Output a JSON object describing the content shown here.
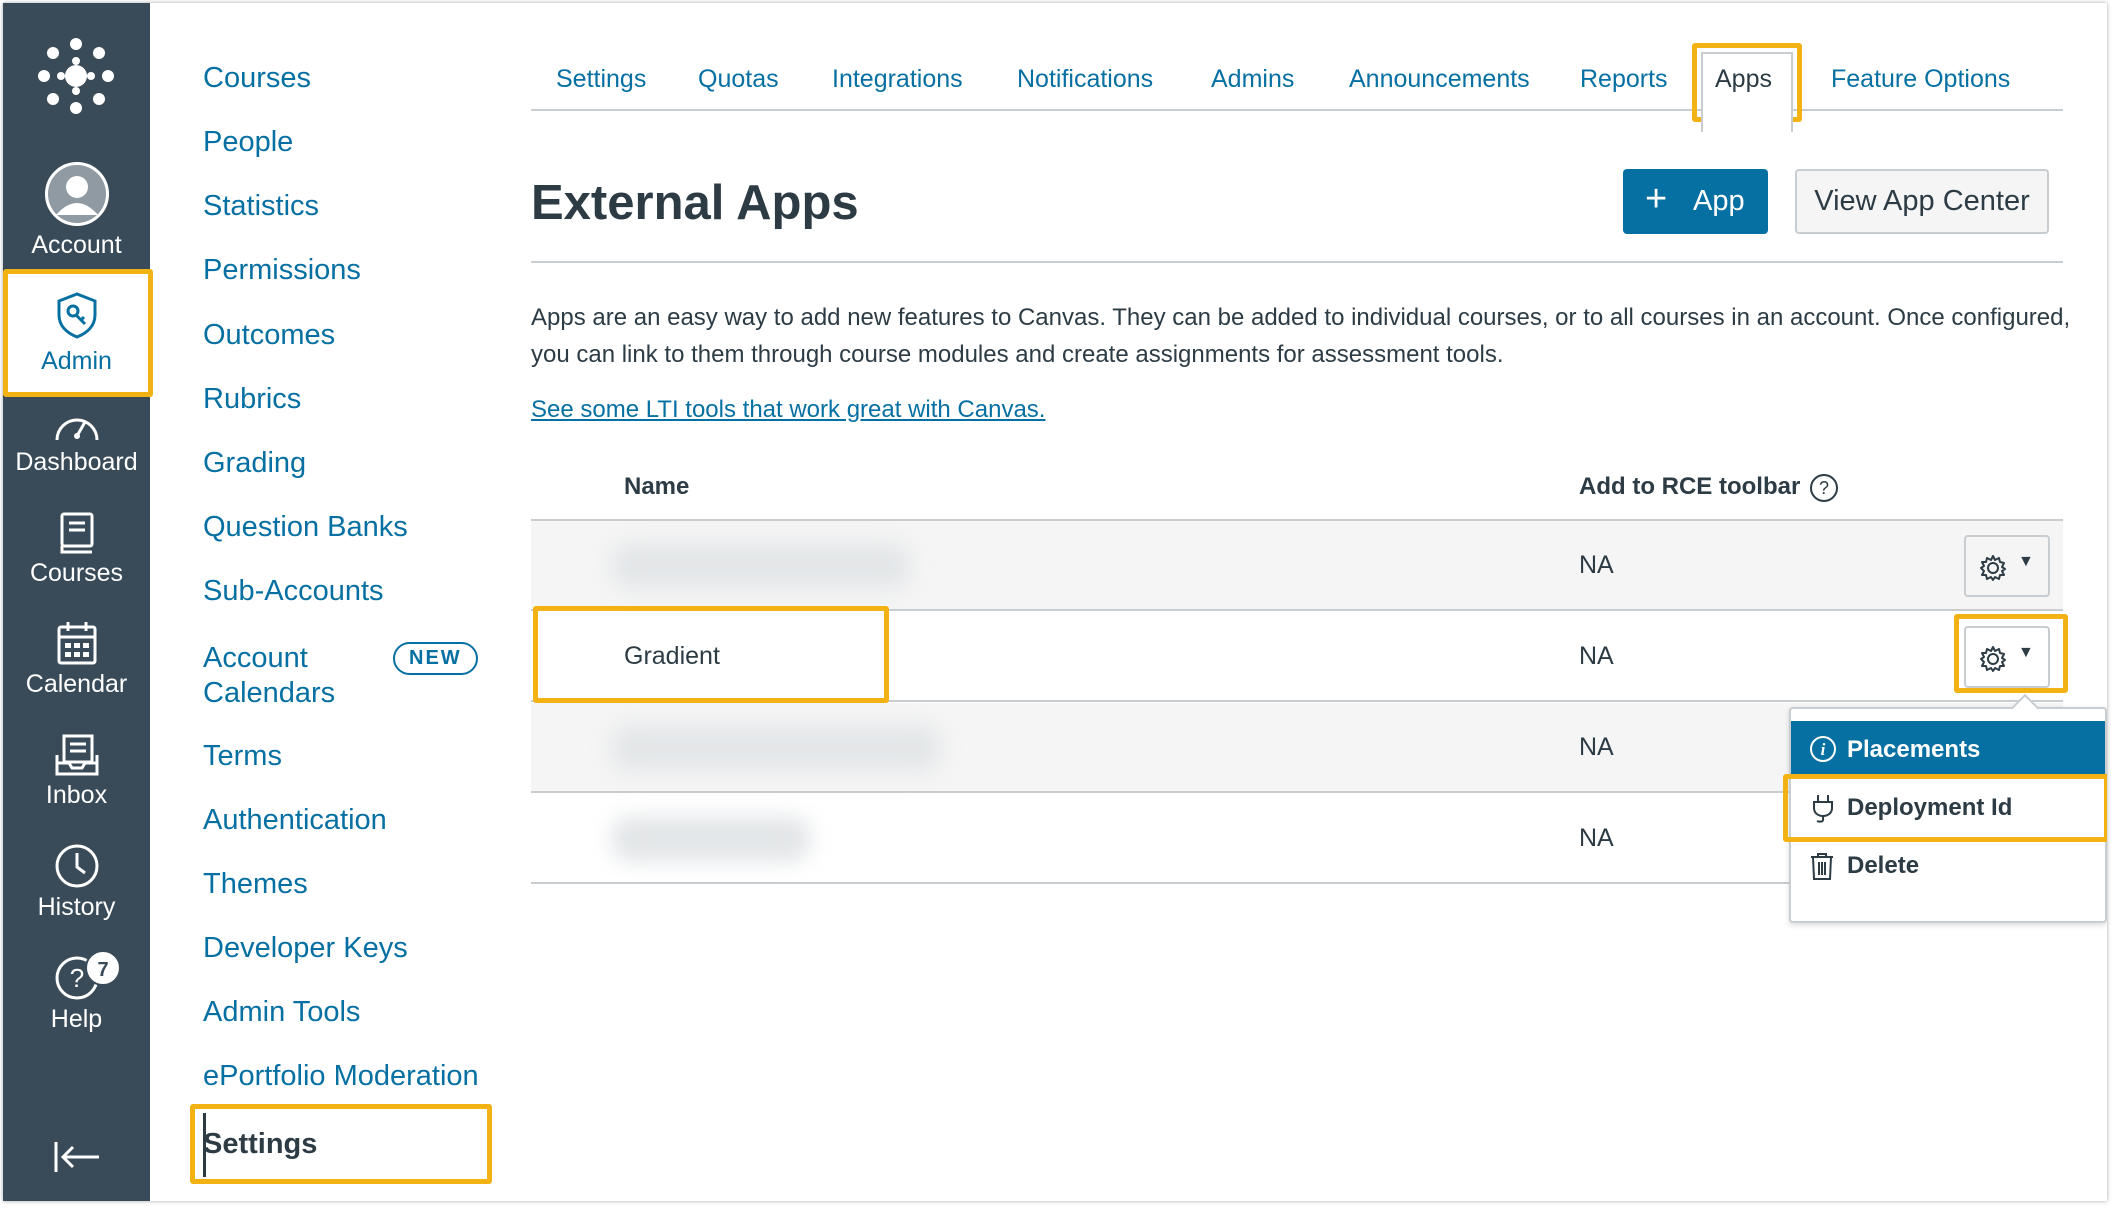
{
  "global_nav": {
    "account": "Account",
    "admin": "Admin",
    "dashboard": "Dashboard",
    "courses": "Courses",
    "calendar": "Calendar",
    "inbox": "Inbox",
    "history": "History",
    "help": "Help",
    "help_badge": "7"
  },
  "subnav": {
    "items": [
      "Courses",
      "People",
      "Statistics",
      "Permissions",
      "Outcomes",
      "Rubrics",
      "Grading",
      "Question Banks",
      "Sub-Accounts"
    ],
    "account_calendars_line1": "Account",
    "account_calendars_line2": "Calendars",
    "new_badge": "NEW",
    "items2": [
      "Terms",
      "Authentication",
      "Themes",
      "Developer Keys",
      "Admin Tools",
      "ePortfolio Moderation"
    ],
    "settings": "Settings"
  },
  "tabs": [
    "Settings",
    "Quotas",
    "Integrations",
    "Notifications",
    "Admins",
    "Announcements",
    "Reports",
    "Apps",
    "Feature Options"
  ],
  "header": {
    "title": "External Apps",
    "add_app_plus": "+",
    "add_app_label": "App",
    "view_app_center": "View App Center"
  },
  "description": "Apps are an easy way to add new features to Canvas. They can be added to individual courses, or to all courses in an account. Once configured, you can link to them through course modules and create assignments for assessment tools.",
  "lti_link": "See some LTI tools that work great with Canvas.",
  "table": {
    "col_name": "Name",
    "col_rce": "Add to RCE toolbar",
    "rows": [
      {
        "name": "",
        "rce": "NA"
      },
      {
        "name": "Gradient",
        "rce": "NA"
      },
      {
        "name": "",
        "rce": "NA"
      },
      {
        "name": "",
        "rce": "NA"
      }
    ]
  },
  "dropdown": {
    "placements": "Placements",
    "deployment_id": "Deployment Id",
    "delete": "Delete"
  },
  "colors": {
    "nav_bg": "#394b58",
    "link_blue": "#0770a3",
    "highlight": "#f3b214",
    "text": "#2d3b45"
  }
}
